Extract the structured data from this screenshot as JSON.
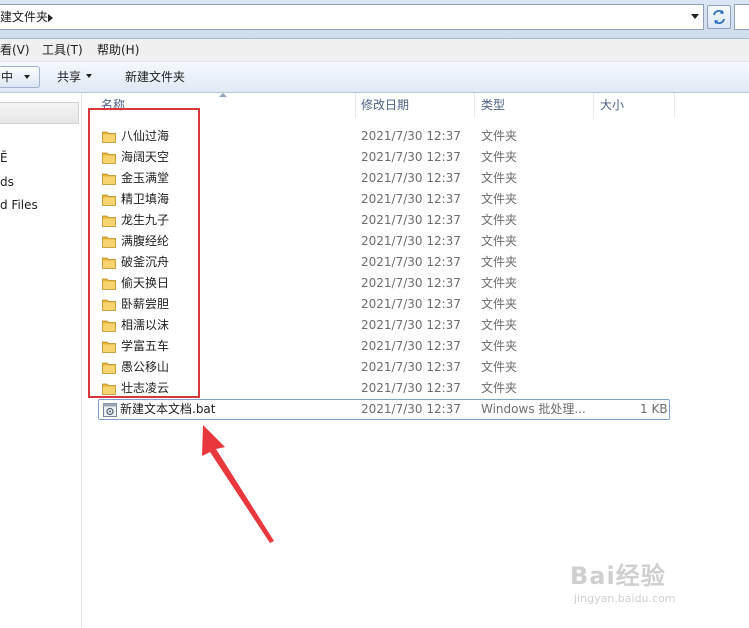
{
  "address": {
    "crumb": "建文件夹"
  },
  "menu": {
    "view": "看(V)",
    "tools": "工具(T)",
    "help": "帮助(H)"
  },
  "toolbar": {
    "organize_fragment": "中",
    "share": "共享",
    "new_folder": "新建文件夹"
  },
  "nav": {
    "items": [
      "Ē",
      "ds",
      "d Files"
    ]
  },
  "columns": {
    "name": "名称",
    "date": "修改日期",
    "type": "类型",
    "size": "大小"
  },
  "files": [
    {
      "name": "八仙过海",
      "date": "2021/7/30 12:37",
      "type": "文件夹",
      "size": "",
      "icon": "folder-icon"
    },
    {
      "name": "海阔天空",
      "date": "2021/7/30 12:37",
      "type": "文件夹",
      "size": "",
      "icon": "folder-icon"
    },
    {
      "name": "金玉满堂",
      "date": "2021/7/30 12:37",
      "type": "文件夹",
      "size": "",
      "icon": "folder-icon"
    },
    {
      "name": "精卫填海",
      "date": "2021/7/30 12:37",
      "type": "文件夹",
      "size": "",
      "icon": "folder-icon"
    },
    {
      "name": "龙生九子",
      "date": "2021/7/30 12:37",
      "type": "文件夹",
      "size": "",
      "icon": "folder-icon"
    },
    {
      "name": "满腹经纶",
      "date": "2021/7/30 12:37",
      "type": "文件夹",
      "size": "",
      "icon": "folder-icon"
    },
    {
      "name": "破釜沉舟",
      "date": "2021/7/30 12:37",
      "type": "文件夹",
      "size": "",
      "icon": "folder-icon"
    },
    {
      "name": "偷天换日",
      "date": "2021/7/30 12:37",
      "type": "文件夹",
      "size": "",
      "icon": "folder-icon"
    },
    {
      "name": "卧薪尝胆",
      "date": "2021/7/30 12:37",
      "type": "文件夹",
      "size": "",
      "icon": "folder-icon"
    },
    {
      "name": "相濡以沫",
      "date": "2021/7/30 12:37",
      "type": "文件夹",
      "size": "",
      "icon": "folder-icon"
    },
    {
      "name": "学富五车",
      "date": "2021/7/30 12:37",
      "type": "文件夹",
      "size": "",
      "icon": "folder-icon"
    },
    {
      "name": "愚公移山",
      "date": "2021/7/30 12:37",
      "type": "文件夹",
      "size": "",
      "icon": "folder-icon"
    },
    {
      "name": "壮志凌云",
      "date": "2021/7/30 12:37",
      "type": "文件夹",
      "size": "",
      "icon": "folder-icon"
    },
    {
      "name": "新建文本文档.bat",
      "date": "2021/7/30 12:37",
      "type": "Windows 批处理...",
      "size": "1 KB",
      "icon": "batch-file-icon"
    }
  ],
  "annotation": {
    "box_color": "#d8373c",
    "arrow_color": "#e8383d"
  },
  "watermark": {
    "logo": "Bai经验",
    "url": "jingyan.baidu.com"
  }
}
